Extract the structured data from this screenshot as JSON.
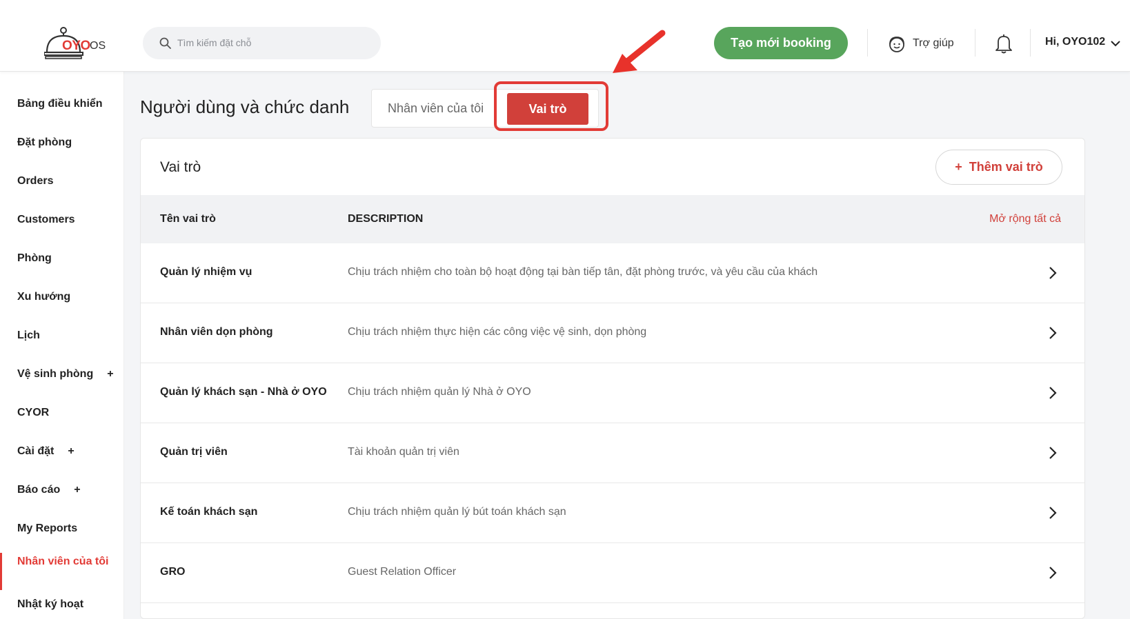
{
  "header": {
    "logo_brand": "OYO",
    "logo_suffix": "OS",
    "search_placeholder": "Tìm kiếm đặt chỗ",
    "new_booking_label": "Tạo mới booking",
    "help_label": "Trợ giúp",
    "user_greeting": "Hi, OYO102"
  },
  "sidebar": {
    "items": [
      {
        "label": "Bảng điều khiển"
      },
      {
        "label": "Đặt phòng"
      },
      {
        "label": "Orders"
      },
      {
        "label": "Customers"
      },
      {
        "label": "Phòng"
      },
      {
        "label": "Xu hướng"
      },
      {
        "label": "Lịch"
      },
      {
        "label": "Vệ sinh phòng",
        "expand": "+"
      },
      {
        "label": "CYOR"
      },
      {
        "label": "Cài đặt",
        "expand": "+"
      },
      {
        "label": "Báo cáo",
        "expand": "+"
      },
      {
        "label": "My Reports"
      },
      {
        "label": "Nhân viên của tôi",
        "active": true
      },
      {
        "label": "Nhật ký hoạt"
      }
    ]
  },
  "page": {
    "title": "Người dùng và chức danh",
    "tabs": [
      {
        "label": "Nhân viên của tôi",
        "active": false
      },
      {
        "label": "Vai trò",
        "active": true
      }
    ]
  },
  "roles_card": {
    "title": "Vai trò",
    "add_button": "Thêm vai trò",
    "add_button_icon": "+",
    "columns": {
      "name": "Tên vai trò",
      "description": "DESCRIPTION",
      "expand_all": "Mở rộng tất cả"
    },
    "rows": [
      {
        "name": "Quản lý nhiệm vụ",
        "description": "Chịu trách nhiệm cho toàn bộ hoạt động tại bàn tiếp tân, đặt phòng trước, và yêu cầu của khách"
      },
      {
        "name": "Nhân viên dọn phòng",
        "description": "Chịu trách nhiệm thực hiện các công việc vệ sinh, dọn phòng"
      },
      {
        "name": "Quản lý khách sạn - Nhà ở OYO",
        "description": "Chịu trách nhiệm quản lý Nhà ở OYO"
      },
      {
        "name": "Quản trị viên",
        "description": "Tài khoản quản trị viên"
      },
      {
        "name": "Kế toán khách sạn",
        "description": "Chịu trách nhiệm quản lý bút toán khách sạn"
      },
      {
        "name": "GRO",
        "description": "Guest Relation Officer"
      }
    ]
  },
  "colors": {
    "brand_red": "#e23b36",
    "button_green": "#58a55c",
    "active_tab_red": "#d1403a"
  },
  "icons": [
    "search-icon",
    "support-icon",
    "bell-icon",
    "chevron-down-icon",
    "chevron-right-icon",
    "annotation-arrow-icon"
  ]
}
